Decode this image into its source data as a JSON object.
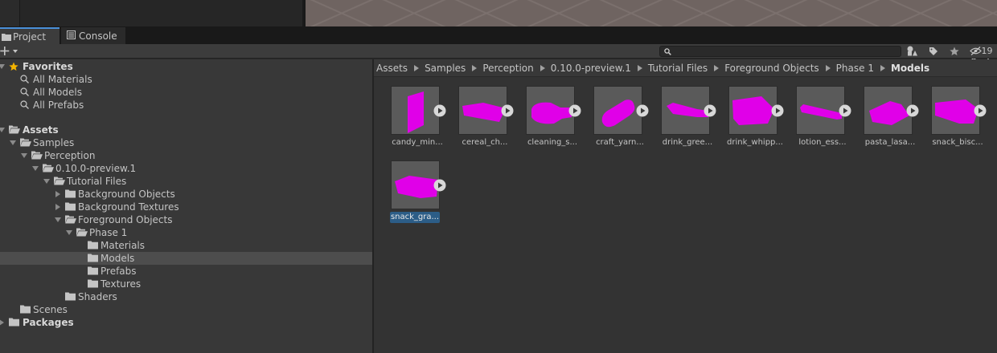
{
  "window": {
    "tabs": [
      {
        "label": "Project",
        "active": true,
        "icon": "folder-icon"
      },
      {
        "label": "Console",
        "active": false,
        "icon": "console-icon"
      }
    ]
  },
  "toolbar": {
    "search_placeholder": "",
    "hidden_count": "19"
  },
  "tree": {
    "favorites": {
      "label": "Favorites",
      "items": [
        "All Materials",
        "All Models",
        "All Prefabs"
      ]
    },
    "assets": {
      "label": "Assets",
      "samples": "Samples",
      "perception": "Perception",
      "version": "0.10.0-preview.1",
      "tutorial": "Tutorial Files",
      "background_objects": "Background Objects",
      "background_textures": "Background Textures",
      "foreground_objects": "Foreground Objects",
      "phase": "Phase 1",
      "materials": "Materials",
      "models": "Models",
      "prefabs": "Prefabs",
      "textures": "Textures",
      "shaders": "Shaders",
      "scenes": "Scenes"
    },
    "packages": "Packages",
    "selected": "Models"
  },
  "breadcrumb": [
    "Assets",
    "Samples",
    "Perception",
    "0.10.0-preview.1",
    "Tutorial Files",
    "Foreground Objects",
    "Phase 1",
    "Models"
  ],
  "assets": [
    {
      "name": "candy_min...",
      "shape": "slab",
      "selected": false
    },
    {
      "name": "cereal_ch...",
      "shape": "box-flat",
      "selected": false
    },
    {
      "name": "cleaning_s...",
      "shape": "bottle",
      "selected": false
    },
    {
      "name": "craft_yarn...",
      "shape": "cylinder",
      "selected": false
    },
    {
      "name": "drink_gree...",
      "shape": "bottle-thin",
      "selected": false
    },
    {
      "name": "drink_whipp...",
      "shape": "box-cube",
      "selected": false
    },
    {
      "name": "lotion_ess...",
      "shape": "tube",
      "selected": false
    },
    {
      "name": "pasta_lasa...",
      "shape": "box-tilt",
      "selected": false
    },
    {
      "name": "snack_bisc...",
      "shape": "box-flat2",
      "selected": false
    },
    {
      "name": "snack_gra...",
      "shape": "box-wide",
      "selected": true
    }
  ],
  "colors": {
    "model_color": "#e000e8",
    "selection": "#2c5d87",
    "tab_accent": "#4a90d9",
    "favorite_star": "#f4b400"
  }
}
